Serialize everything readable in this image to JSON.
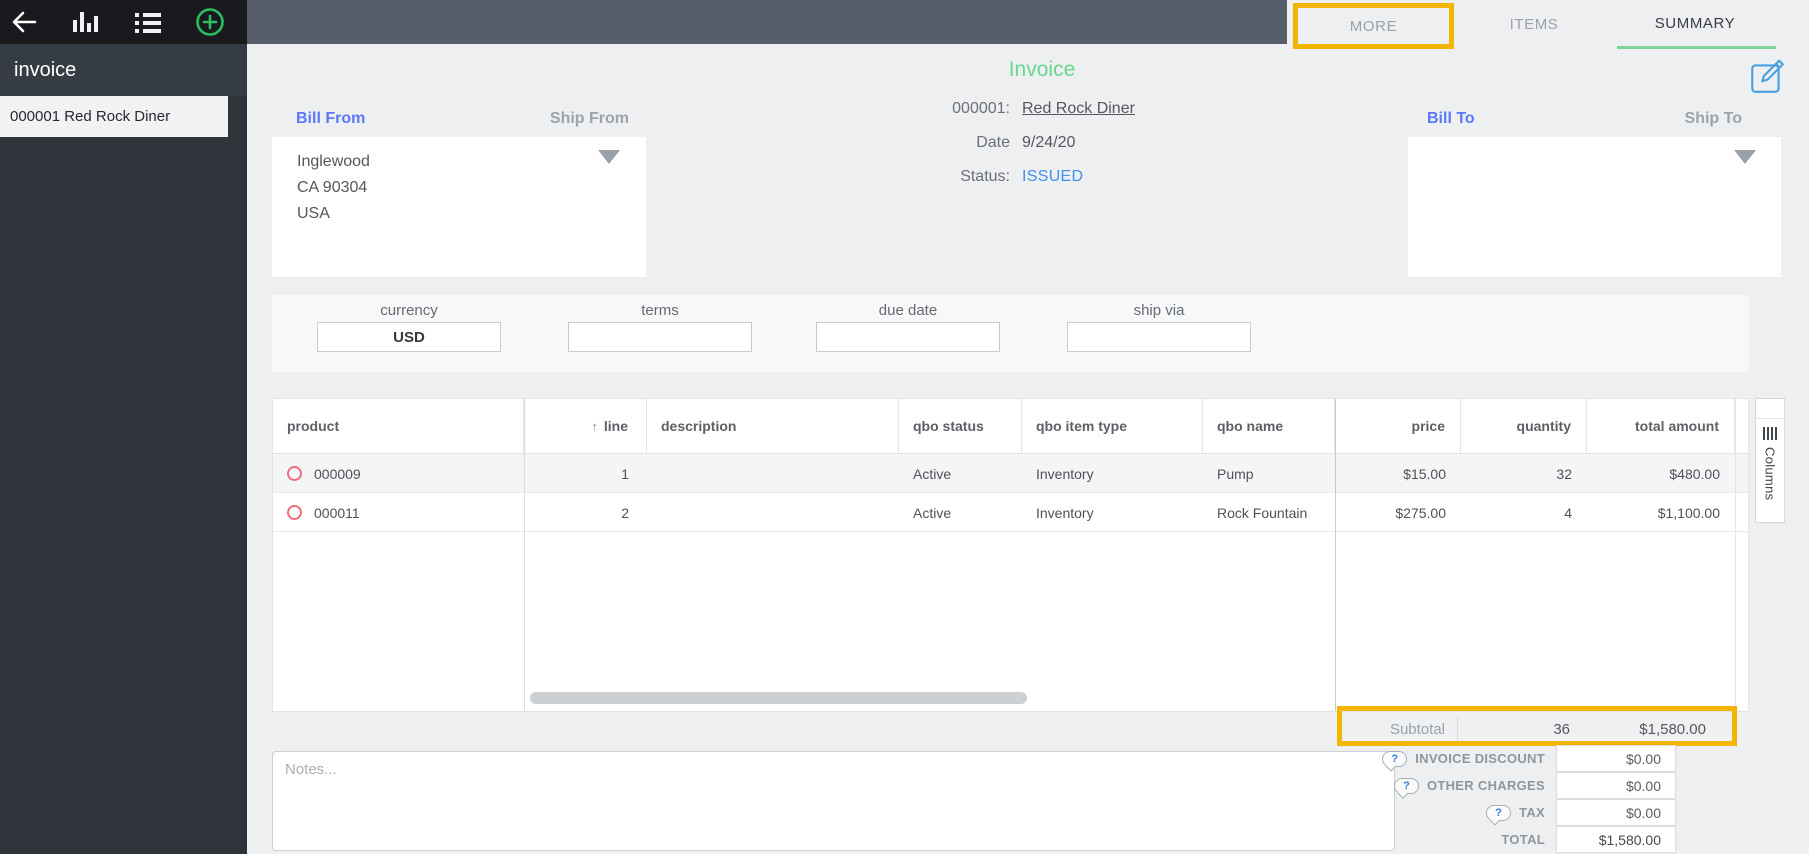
{
  "sidebar": {
    "title": "invoice",
    "items": [
      {
        "label": "000001 Red Rock Diner"
      }
    ]
  },
  "tabs": {
    "more": "MORE",
    "items": "ITEMS",
    "summary": "SUMMARY"
  },
  "invoice": {
    "title": "Invoice",
    "number": "000001:",
    "customer": "Red Rock Diner",
    "date_label": "Date",
    "date": "9/24/20",
    "status_label": "Status:",
    "status": "ISSUED"
  },
  "addresses": {
    "bill_from": "Bill From",
    "ship_from": "Ship From",
    "bill_from_lines": [
      "Inglewood",
      "CA 90304",
      "USA"
    ],
    "bill_to": "Bill To",
    "ship_to": "Ship To"
  },
  "details": {
    "currency_label": "currency",
    "currency_value": "USD",
    "terms_label": "terms",
    "terms_value": "",
    "due_date_label": "due date",
    "due_date_value": "",
    "ship_via_label": "ship via",
    "ship_via_value": ""
  },
  "table": {
    "columns": [
      "product",
      "line",
      "description",
      "qbo status",
      "qbo item type",
      "qbo name",
      "price",
      "quantity",
      "total amount"
    ],
    "sort_icon": "↑",
    "rows": [
      {
        "product": "000009",
        "line": "1",
        "description": "",
        "qbo_status": "Active",
        "qbo_item_type": "Inventory",
        "qbo_name": "Pump",
        "price": "$15.00",
        "quantity": "32",
        "total_amount": "$480.00"
      },
      {
        "product": "000011",
        "line": "2",
        "description": "",
        "qbo_status": "Active",
        "qbo_item_type": "Inventory",
        "qbo_name": "Rock Fountain",
        "price": "$275.00",
        "quantity": "4",
        "total_amount": "$1,100.00"
      }
    ],
    "columns_button": "Columns",
    "subtotal": {
      "label": "Subtotal",
      "quantity": "36",
      "amount": "$1,580.00"
    }
  },
  "notes": {
    "placeholder": "Notes..."
  },
  "totals": {
    "help_icon": "?",
    "rows": [
      {
        "label": "INVOICE DISCOUNT",
        "value": "$0.00"
      },
      {
        "label": "OTHER CHARGES",
        "value": "$0.00"
      },
      {
        "label": "TAX",
        "value": "$0.00"
      },
      {
        "label": "TOTAL",
        "value": "$1,580.00"
      }
    ]
  },
  "colors": {
    "accent_green": "#67d98b",
    "accent_blue": "#5b79f7",
    "status_blue": "#4191ec",
    "highlight_yellow": "#f2b600",
    "tab_underline_green": "#7ed494",
    "edit_icon_blue": "#45a1e1",
    "add_icon_green": "#2cbd60",
    "row_marker_red": "#ee6d7d"
  }
}
